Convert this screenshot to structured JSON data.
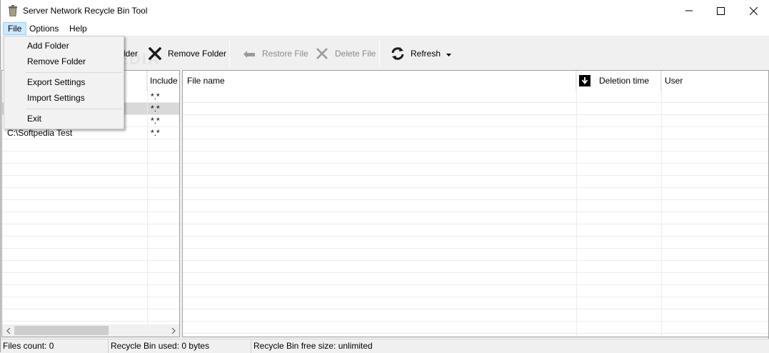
{
  "window": {
    "title": "Server Network Recycle Bin Tool"
  },
  "menu": {
    "file": "File",
    "options": "Options",
    "help": "Help"
  },
  "file_menu": {
    "add_folder": "Add Folder",
    "remove_folder": "Remove Folder",
    "export_settings": "Export Settings",
    "import_settings": "Import Settings",
    "exit": "Exit"
  },
  "toolbar": {
    "add_folder_partial": "lder",
    "remove_folder": "Remove Folder",
    "restore_file": "Restore File",
    "delete_file": "Delete File",
    "refresh": "Refresh"
  },
  "folders": {
    "col_include": "Include",
    "rows": [
      {
        "path": "",
        "include": "*.*"
      },
      {
        "path": "",
        "include": "*.*"
      },
      {
        "path": "",
        "include": "*.*"
      },
      {
        "path": "C:\\Softpedia Test",
        "include": "*.*"
      }
    ]
  },
  "files": {
    "col_file_name": "File name",
    "col_deletion_time": "Deletion time",
    "col_user": "User",
    "rows": []
  },
  "status": {
    "files_count": "Files count: 0",
    "recycle_used": "Recycle Bin used: 0 bytes",
    "recycle_free": "Recycle Bin free size: unlimited"
  },
  "watermark": "SOFTPEDIA",
  "colors": {
    "menu_active_bg": "#cce8ff",
    "menu_active_border": "#99d1ff",
    "selected_row": "#d9d9d9"
  }
}
